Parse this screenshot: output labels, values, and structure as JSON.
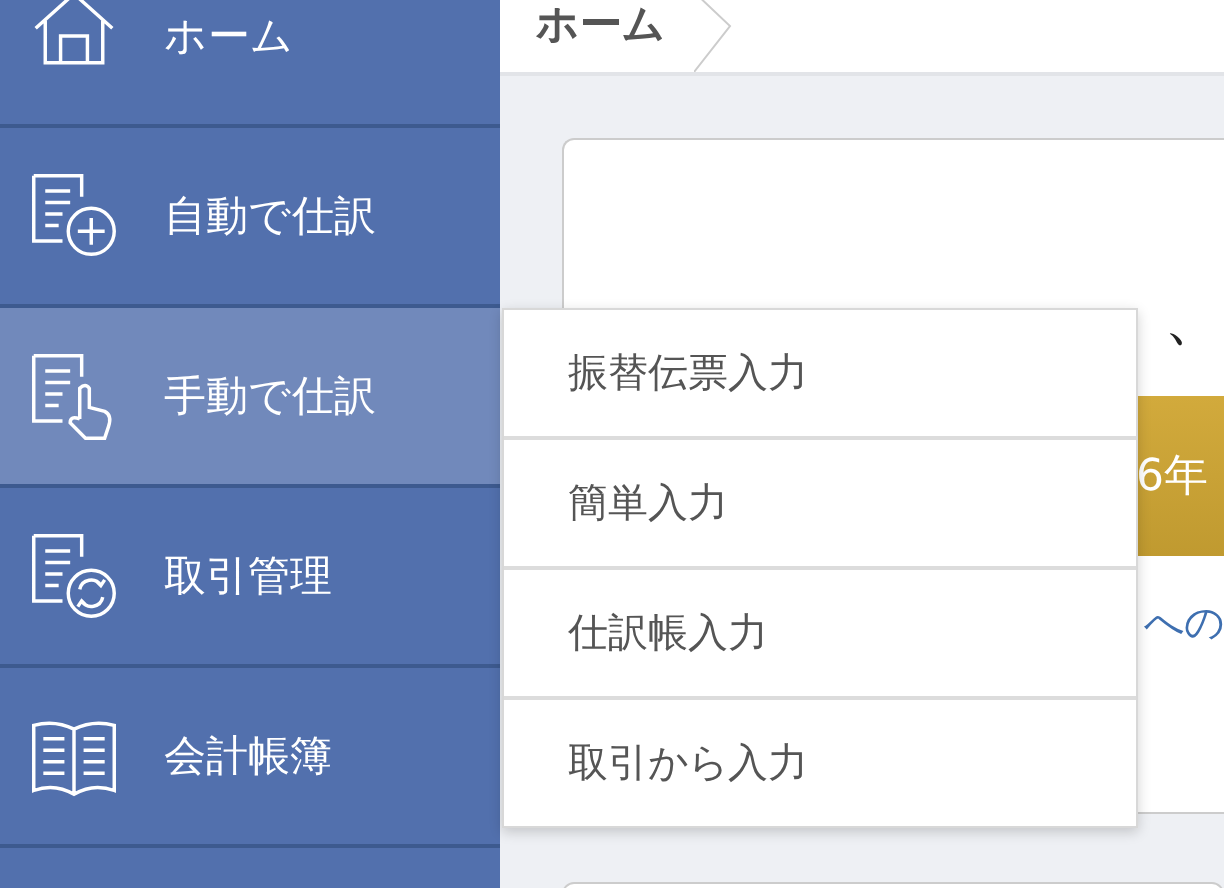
{
  "sidebar": {
    "items": [
      {
        "label": "ホーム",
        "selected": false
      },
      {
        "label": "自動で仕訳",
        "selected": false
      },
      {
        "label": "手動で仕訳",
        "selected": true
      },
      {
        "label": "取引管理",
        "selected": false
      },
      {
        "label": "会計帳簿",
        "selected": false
      }
    ]
  },
  "breadcrumb": [
    "ホーム"
  ],
  "card": {
    "greeting": "、",
    "banner": "6年",
    "link": "への"
  },
  "submenu": {
    "items": [
      "振替伝票入力",
      "簡単入力",
      "仕訳帳入力",
      "取引から入力"
    ]
  }
}
